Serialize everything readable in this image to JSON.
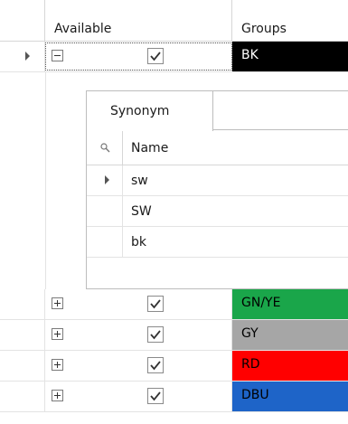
{
  "header": {
    "available_label": "Available",
    "groups_label": "Groups"
  },
  "rows": [
    {
      "group": "BK",
      "color": "#000000",
      "text_color": "#ffffff",
      "checked": true,
      "expanded": true,
      "current": true
    },
    {
      "group": "GN/YE",
      "color": "#1aa64a",
      "text_color": "#000000",
      "checked": true,
      "expanded": false
    },
    {
      "group": "GY",
      "color": "#a6a6a6",
      "text_color": "#000000",
      "checked": true,
      "expanded": false
    },
    {
      "group": "RD",
      "color": "#ff0000",
      "text_color": "#000000",
      "checked": true,
      "expanded": false
    },
    {
      "group": "DBU",
      "color": "#1e64c8",
      "text_color": "#000000",
      "checked": true,
      "expanded": false
    }
  ],
  "detail": {
    "tab_label": "Synonym",
    "column_name": "Name",
    "items": [
      "sw",
      "SW",
      "bk"
    ]
  }
}
